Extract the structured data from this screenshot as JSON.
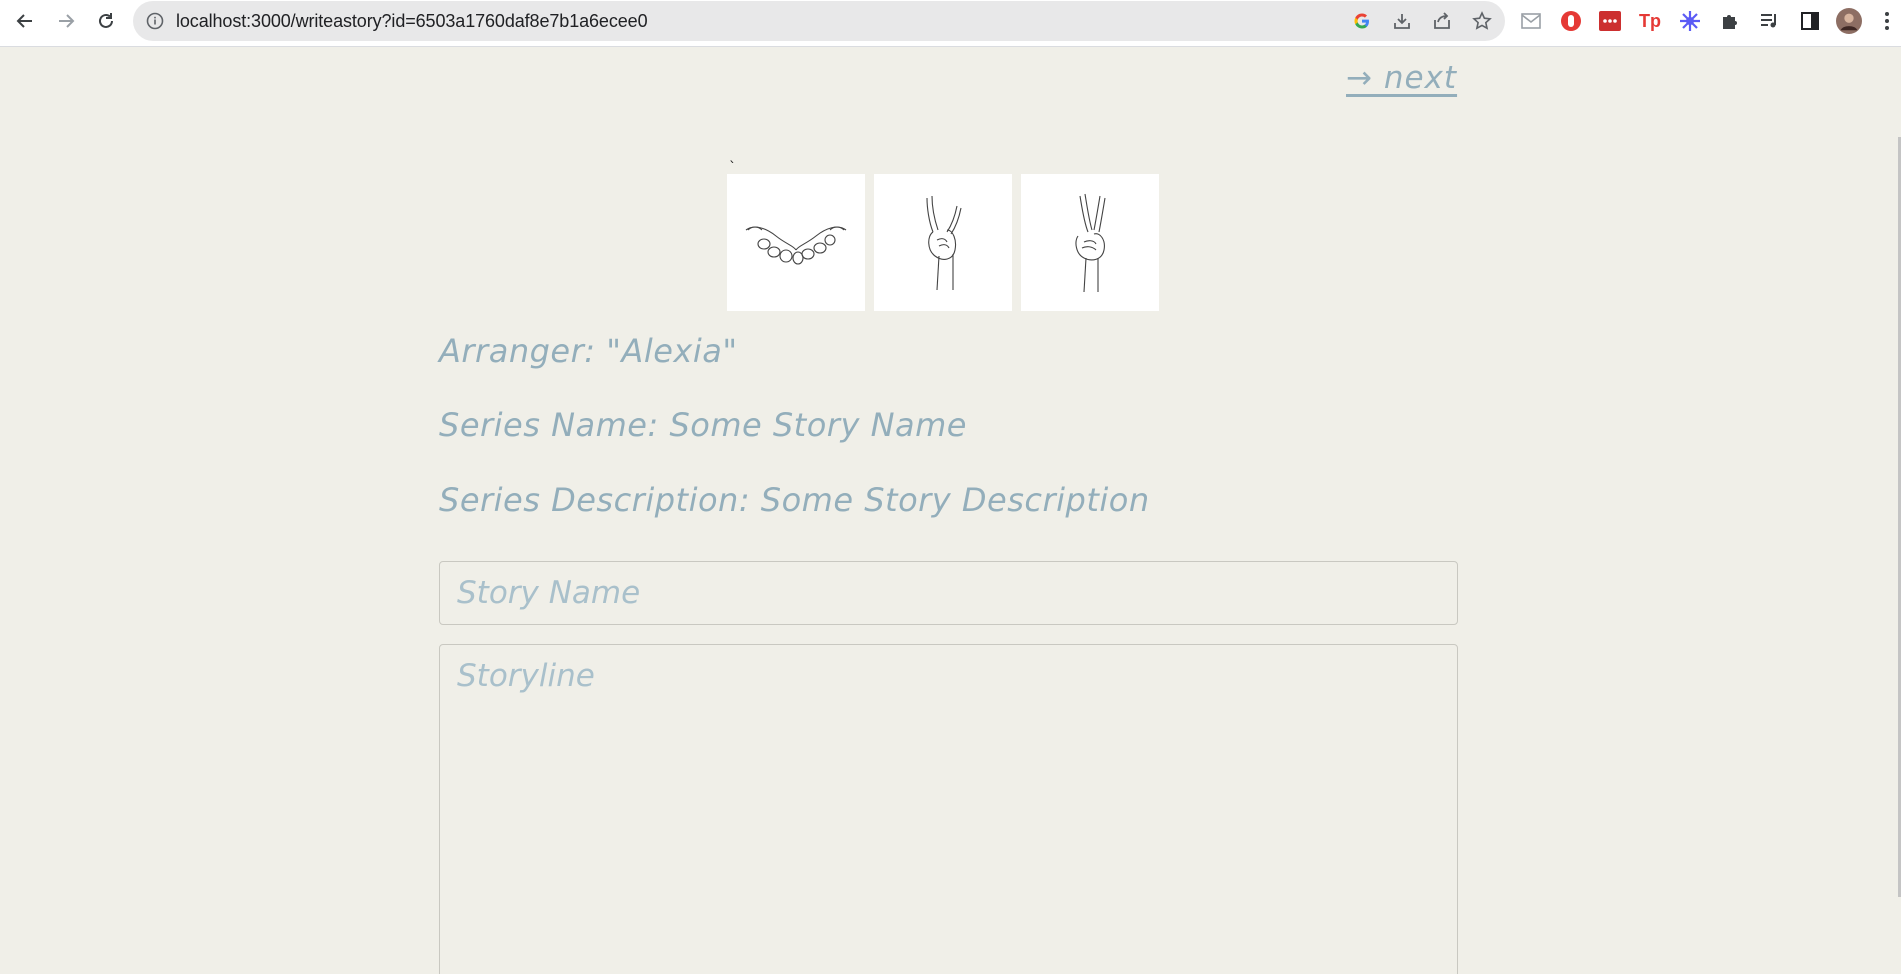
{
  "browser": {
    "url": "localhost:3000/writeastory?id=6503a1760daf8e7b1a6ecee0",
    "icons": [
      "back-arrow-icon",
      "forward-arrow-icon",
      "reload-icon",
      "info-icon",
      "google-icon",
      "download-icon",
      "share-icon",
      "star-icon",
      "mail-icon",
      "adblock-icon",
      "lastpass-icon",
      "tp-icon",
      "extension-flower-icon",
      "puzzle-icon",
      "media-queue-icon",
      "sidebar-icon",
      "avatar",
      "more-vert-icon"
    ],
    "colors": {
      "red_ext": "#d32f2f",
      "blue_ext": "#5b5bf5"
    }
  },
  "page": {
    "next_label": "→ next",
    "tick_mark": "`",
    "cards": [
      {
        "name": "open-hands-illustration"
      },
      {
        "name": "rock-hand-illustration"
      },
      {
        "name": "peace-hand-illustration"
      }
    ],
    "arranger": "Arranger: \"Alexia\"",
    "series_name": "Series Name: Some Story Name",
    "series_description": "Series Description: Some Story Description",
    "story_name_placeholder": "Story Name",
    "storyline_placeholder": "Storyline",
    "accent": "#93aebb",
    "background": "#f0efe8"
  }
}
